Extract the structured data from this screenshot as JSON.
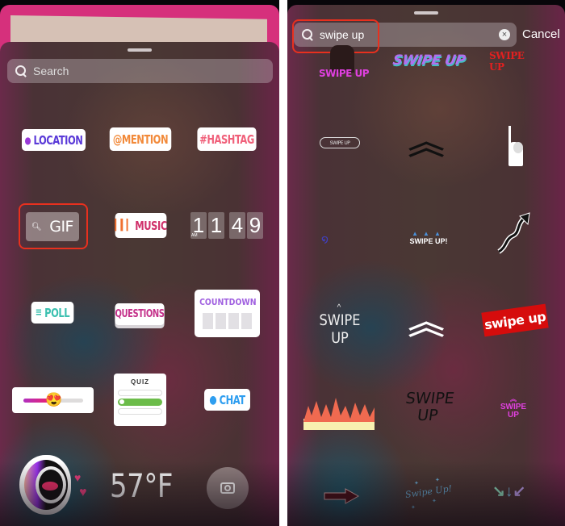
{
  "left": {
    "search": {
      "placeholder": "Search"
    },
    "stickers": {
      "location": "LOCATION",
      "mention": "@MENTION",
      "hashtag": "#HASHTAG",
      "gif": "GIF",
      "music": "MUSIC",
      "clock": {
        "digits": [
          "1",
          "1",
          "4",
          "9"
        ],
        "ampm": "AM"
      },
      "poll": "POLL",
      "questions": "QUESTIONS",
      "countdown": "COUNTDOWN",
      "quiz": "QUIZ",
      "chat": "CHAT",
      "temperature": "57°F"
    }
  },
  "right": {
    "search": {
      "value": "swipe up",
      "cancel_label": "Cancel"
    },
    "results": [
      {
        "label": "SWIPE UP",
        "style": "pink-photo"
      },
      {
        "label": "SWIPE UP",
        "style": "holographic-3d"
      },
      {
        "label": "SWIPE UP",
        "style": "red-brush"
      },
      {
        "label": "SWIPE UP",
        "style": "outlined-pill"
      },
      {
        "label": "",
        "style": "double-chevron-black"
      },
      {
        "label": "",
        "style": "pointing-figure"
      },
      {
        "label": "",
        "style": "blue-squiggle"
      },
      {
        "label": "SWIPE UP!",
        "style": "blue-carets"
      },
      {
        "label": "",
        "style": "curvy-arrow"
      },
      {
        "label": "SWIPE UP",
        "style": "handwritten-caret"
      },
      {
        "label": "",
        "style": "double-chevron-white"
      },
      {
        "label": "swipe up",
        "style": "red-banner"
      },
      {
        "label": "",
        "style": "flames"
      },
      {
        "label": "SWIPE UP",
        "style": "handwritten-black"
      },
      {
        "label": "SWIPE UP",
        "style": "pink-pixel"
      },
      {
        "label": "",
        "style": "right-arrow"
      },
      {
        "label": "Swipe Up!",
        "style": "script-stars"
      },
      {
        "label": "",
        "style": "pastel-arrows"
      }
    ]
  }
}
